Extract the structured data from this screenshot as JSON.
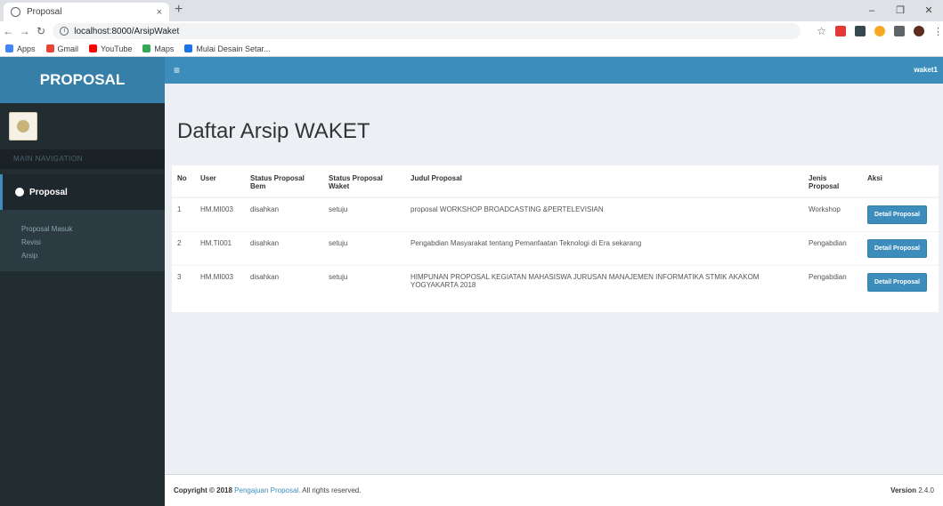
{
  "browser": {
    "tab_title": "Proposal",
    "tab_close": "×",
    "new_tab": "+",
    "url": "localhost:8000/ArsipWaket",
    "window_controls": [
      "–",
      "❐",
      "✕"
    ],
    "bookmarks": [
      {
        "label": "Apps",
        "color": "#4285f4"
      },
      {
        "label": "Gmail",
        "color": "#ea4335"
      },
      {
        "label": "YouTube",
        "color": "#ff0000"
      },
      {
        "label": "Maps",
        "color": "#34a853"
      },
      {
        "label": "Mulai Desain Setar...",
        "color": "#1a73e8"
      }
    ]
  },
  "app": {
    "brand": "PROPOSAL",
    "toggle_icon": "≡",
    "username": "waket1",
    "sidebar": {
      "header": "MAIN NAVIGATION",
      "menu_label": "Proposal",
      "submenu": [
        "Proposal Masuk",
        "Revisi",
        "Arsip"
      ]
    },
    "page_title": "Daftar Arsip WAKET",
    "table": {
      "headers": [
        "No",
        "User",
        "Status Proposal Bem",
        "Status Proposal Waket",
        "Judul Proposal",
        "Jenis Proposal",
        "Aksi"
      ],
      "rows": [
        {
          "no": "1",
          "user": "HM.MI003",
          "status_bem": "disahkan",
          "status_waket": "setuju",
          "judul": "proposal WORKSHOP BROADCASTING &PERTELEVISIAN",
          "jenis": "Workshop",
          "aksi": "Detail Proposal"
        },
        {
          "no": "2",
          "user": "HM.TI001",
          "status_bem": "disahkan",
          "status_waket": "setuju",
          "judul": "Pengabdian Masyarakat tentang Pemanfaatan Teknologi di Era sekarang",
          "jenis": "Pengabdian",
          "aksi": "Detail Proposal"
        },
        {
          "no": "3",
          "user": "HM.MI003",
          "status_bem": "disahkan",
          "status_waket": "setuju",
          "judul": "HIMPUNAN PROPOSAL KEGIATAN MAHASISWA JURUSAN MANAJEMEN INFORMATIKA STMIK AKAKOM YOGYAKARTA 2018",
          "jenis": "Pengabdian",
          "aksi": "Detail Proposal"
        }
      ]
    },
    "footer": {
      "copyright_prefix": "Copyright © 2018",
      "copyright_link": "Pengajuan Proposal.",
      "copyright_suffix": "All rights reserved.",
      "version_label": "Version",
      "version": "2.4.0"
    }
  },
  "colors": {
    "primary": "#3c8dbc",
    "brand_bg": "#367fa9",
    "sidebar_bg": "#222d32"
  }
}
